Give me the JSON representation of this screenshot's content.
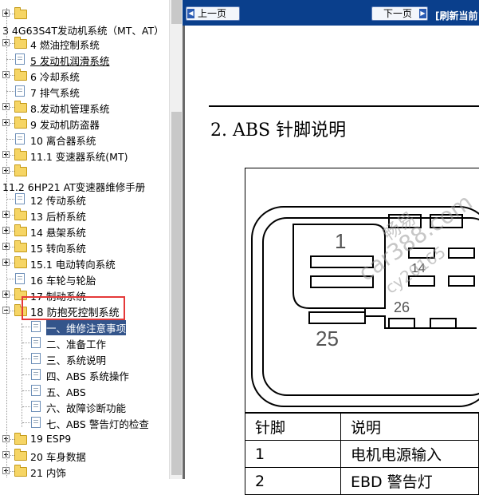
{
  "tree": {
    "items": [
      {
        "label": "",
        "type": "folder",
        "expander": "plus"
      },
      {
        "label": "3 4G63S4T发动机系统（MT、AT）",
        "type": "text"
      },
      {
        "label": "4 燃油控制系统",
        "type": "folder",
        "expander": "plus"
      },
      {
        "label": "5 发动机润滑系统",
        "type": "page",
        "underlined": true
      },
      {
        "label": "6 冷却系统",
        "type": "folder",
        "expander": "plus"
      },
      {
        "label": "7 排气系统",
        "type": "page"
      },
      {
        "label": "8.发动机管理系统",
        "type": "folder",
        "expander": "plus"
      },
      {
        "label": "9 发动机防盗器",
        "type": "folder",
        "expander": "plus"
      },
      {
        "label": "10 离合器系统",
        "type": "page"
      },
      {
        "label": "11.1 变速器系统(MT)",
        "type": "folder",
        "expander": "plus"
      },
      {
        "label": "",
        "type": "folder",
        "expander": "plus"
      },
      {
        "label": "11.2 6HP21 AT变速器维修手册",
        "type": "text"
      },
      {
        "label": "12 传动系统",
        "type": "page"
      },
      {
        "label": "13 后桥系统",
        "type": "folder",
        "expander": "plus"
      },
      {
        "label": "14 悬架系统",
        "type": "folder",
        "expander": "plus"
      },
      {
        "label": "15 转向系统",
        "type": "folder",
        "expander": "plus"
      },
      {
        "label": "15.1 电动转向系统",
        "type": "folder",
        "expander": "plus"
      },
      {
        "label": "16 车轮与轮胎",
        "type": "page"
      },
      {
        "label": "17 制动系统",
        "type": "folder",
        "expander": "plus"
      },
      {
        "label": "18 防抱死控制系统",
        "type": "folder",
        "expander": "minus"
      },
      {
        "label": "一、维修注意事项",
        "type": "page",
        "child": true,
        "selected": true
      },
      {
        "label": "二、准备工作",
        "type": "page",
        "child": true
      },
      {
        "label": "三、系统说明",
        "type": "page",
        "child": true
      },
      {
        "label": "四、ABS 系统操作",
        "type": "page",
        "child": true
      },
      {
        "label": "五、ABS",
        "type": "page",
        "child": true
      },
      {
        "label": "六、故障诊断功能",
        "type": "page",
        "child": true
      },
      {
        "label": "七、ABS 警告灯的检查",
        "type": "page",
        "child": true
      },
      {
        "label": "19 ESP9",
        "type": "folder",
        "expander": "plus"
      },
      {
        "label": "20 车身数据",
        "type": "folder",
        "expander": "plus"
      },
      {
        "label": "21 内饰",
        "type": "folder",
        "expander": "plus"
      }
    ]
  },
  "toolbar": {
    "prev_label": "上一页",
    "next_label": "下一页",
    "refresh_label": "[刷新当前"
  },
  "doc": {
    "heading": "2. ABS 针脚说明",
    "diagram_labels": [
      "1",
      "14",
      "26",
      "25"
    ],
    "table": {
      "headers": [
        "针脚",
        "说明"
      ],
      "rows": [
        [
          "1",
          "电机电源输入"
        ],
        [
          "2",
          "EBD 警告灯"
        ]
      ]
    },
    "watermark": [
      "畅易",
      "car388.com",
      "cy20165"
    ]
  },
  "colors": {
    "toolbar_bg": "#0a3f8c",
    "selection": "#34558b",
    "highlight_box": "#e53939"
  }
}
